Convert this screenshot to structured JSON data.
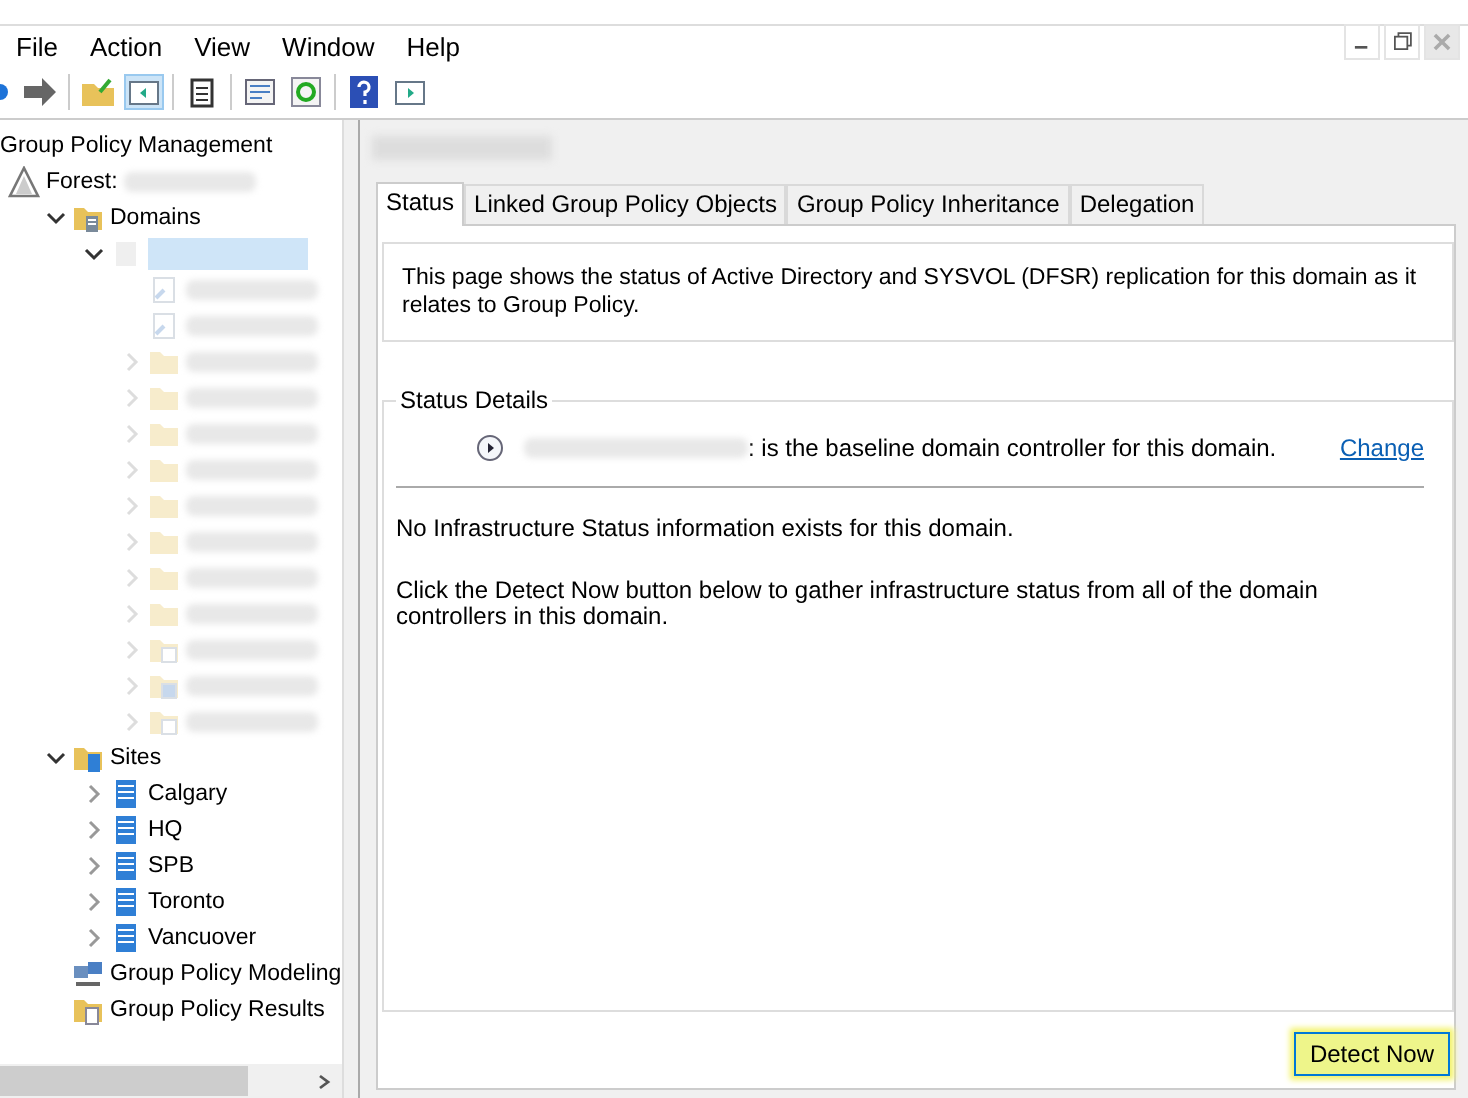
{
  "menu": [
    "File",
    "Action",
    "View",
    "Window",
    "Help"
  ],
  "tree": [
    {
      "label": "Group Policy Management",
      "children": [
        {
          "kind": "forest",
          "label": "Forest:",
          "redacted": true,
          "children": [
            {
              "kind": "domains",
              "label": "Domains",
              "expanded": true,
              "children": [
                {
                  "kind": "domain",
                  "redacted": true,
                  "selected": true,
                  "expanded": true,
                  "children": [
                    {
                      "kind": "gpo-link",
                      "redacted": true
                    },
                    {
                      "kind": "gpo-link",
                      "redacted": true
                    },
                    {
                      "kind": "ou",
                      "redacted": true
                    },
                    {
                      "kind": "ou",
                      "redacted": true
                    },
                    {
                      "kind": "ou",
                      "redacted": true
                    },
                    {
                      "kind": "ou",
                      "redacted": true
                    },
                    {
                      "kind": "ou",
                      "redacted": true
                    },
                    {
                      "kind": "ou",
                      "redacted": true
                    },
                    {
                      "kind": "ou",
                      "redacted": true
                    },
                    {
                      "kind": "ou",
                      "redacted": true
                    },
                    {
                      "kind": "gpo-folder",
                      "redacted": true
                    },
                    {
                      "kind": "wmi-folder",
                      "redacted": true
                    },
                    {
                      "kind": "starter-folder",
                      "redacted": true
                    }
                  ]
                }
              ]
            },
            {
              "kind": "sites",
              "label": "Sites",
              "expanded": true,
              "children": [
                {
                  "kind": "site",
                  "label": "Calgary"
                },
                {
                  "kind": "site",
                  "label": "HQ"
                },
                {
                  "kind": "site",
                  "label": "SPB"
                },
                {
                  "kind": "site",
                  "label": "Toronto"
                },
                {
                  "kind": "site",
                  "label": "Vancuover"
                }
              ]
            },
            {
              "kind": "modeling",
              "label": "Group Policy Modeling"
            },
            {
              "kind": "results",
              "label": "Group Policy Results"
            }
          ]
        }
      ]
    }
  ],
  "content": {
    "header_redacted": true,
    "tabs": [
      {
        "label": "Status",
        "selected": true
      },
      {
        "label": "Linked Group Policy Objects",
        "selected": false
      },
      {
        "label": "Group Policy Inheritance",
        "selected": false
      },
      {
        "label": "Delegation",
        "selected": false
      }
    ],
    "description": "This page shows the status of Active Directory and SYSVOL (DFSR) replication for this domain as it relates to Group Policy.",
    "status_details": {
      "title": "Status Details",
      "baseline_text": ": is the baseline domain controller for this domain.",
      "change_link": "Change",
      "message": "No Infrastructure Status information exists for this domain.",
      "instruction": "Click the Detect Now button below to gather infrastructure status from all of the domain controllers in this domain."
    },
    "detect_button": {
      "label": "Detect Now",
      "highlighted": true
    }
  }
}
